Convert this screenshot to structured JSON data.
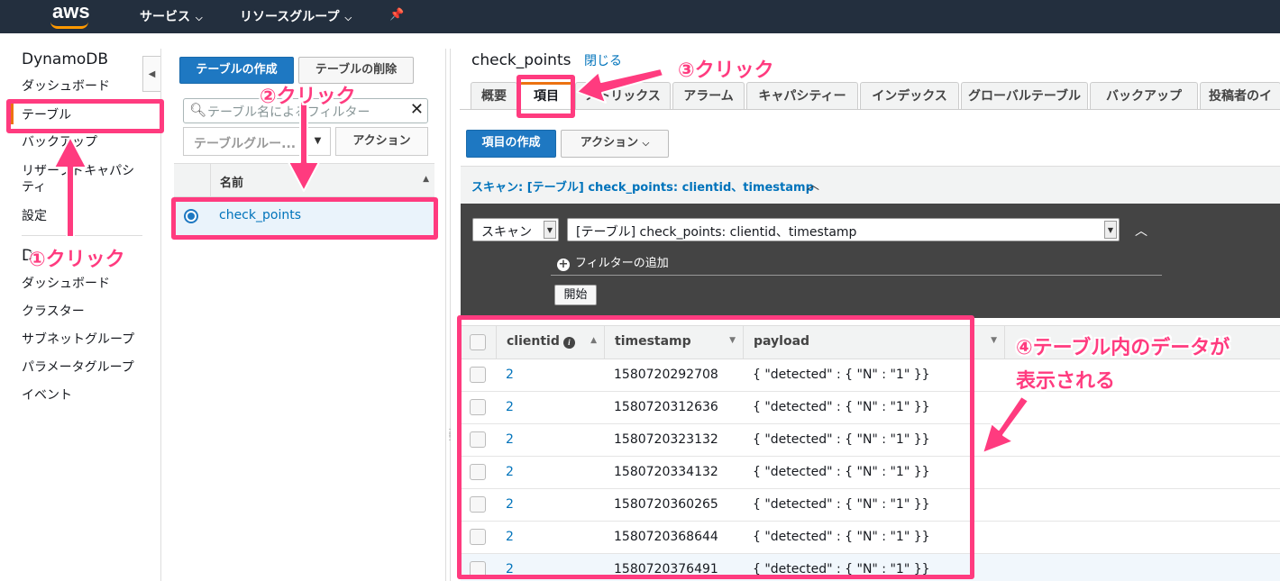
{
  "topnav": {
    "logo": "aws",
    "services": "サービス",
    "resource_groups": "リソースグループ",
    "pin_icon": "pin-icon"
  },
  "sidebar": {
    "title": "DynamoDB",
    "items": [
      {
        "label": "ダッシュボード"
      },
      {
        "label": "テーブル"
      },
      {
        "label": "バックアップ"
      },
      {
        "label": "リザーブドキャパシティ"
      },
      {
        "label": "設定"
      }
    ],
    "section2_initial": "D",
    "items2": [
      {
        "label": "ダッシュボード"
      },
      {
        "label": "クラスター"
      },
      {
        "label": "サブネットグループ"
      },
      {
        "label": "パラメータグループ"
      },
      {
        "label": "イベント"
      }
    ]
  },
  "middle": {
    "create_table_label": "テーブルの作成",
    "delete_table_label": "テーブルの削除",
    "search_placeholder": "テーブル名によるフィルター",
    "group_placeholder": "テーブルグルー...",
    "action_label": "アクション",
    "col_name": "名前",
    "rows": [
      {
        "name": "check_points",
        "selected": true
      }
    ]
  },
  "right": {
    "table_name": "check_points",
    "close_label": "閉じる",
    "tabs": [
      "概要",
      "項目",
      "メトリックス",
      "アラーム",
      "キャパシティー",
      "インデックス",
      "グローバルテーブル",
      "バックアップ",
      "投稿者のイ"
    ],
    "active_tab": "項目",
    "create_item_label": "項目の作成",
    "action_label": "アクション",
    "scan_title": "スキャン: [テーブル] check_points: clientid、timestamp",
    "scan_mode": "スキャン",
    "scan_target": "[テーブル] check_points: clientid、timestamp",
    "add_filter_label": "フィルターの追加",
    "start_label": "開始",
    "columns": [
      "clientid",
      "timestamp",
      "payload"
    ],
    "rows": [
      {
        "clientid": "2",
        "timestamp": "1580720292708",
        "payload": "{ \"detected\" : { \"N\" : \"1\" }}"
      },
      {
        "clientid": "2",
        "timestamp": "1580720312636",
        "payload": "{ \"detected\" : { \"N\" : \"1\" }}"
      },
      {
        "clientid": "2",
        "timestamp": "1580720323132",
        "payload": "{ \"detected\" : { \"N\" : \"1\" }}"
      },
      {
        "clientid": "2",
        "timestamp": "1580720334132",
        "payload": "{ \"detected\" : { \"N\" : \"1\" }}"
      },
      {
        "clientid": "2",
        "timestamp": "1580720360265",
        "payload": "{ \"detected\" : { \"N\" : \"1\" }}"
      },
      {
        "clientid": "2",
        "timestamp": "1580720368644",
        "payload": "{ \"detected\" : { \"N\" : \"1\" }}"
      },
      {
        "clientid": "2",
        "timestamp": "1580720376491",
        "payload": "{ \"detected\" : { \"N\" : \"1\" }}"
      }
    ]
  },
  "annotations": {
    "step1": "①クリック",
    "step2": "②クリック",
    "step3": "③クリック",
    "step4_line1": "④テーブル内のデータが",
    "step4_line2": "表示される",
    "color": "#ff3b7f"
  },
  "colors": {
    "nav_bg": "#232f3e",
    "primary": "#1e78c2",
    "link": "#0073bb",
    "accent": "#ec7211",
    "dark_panel": "#444444"
  }
}
